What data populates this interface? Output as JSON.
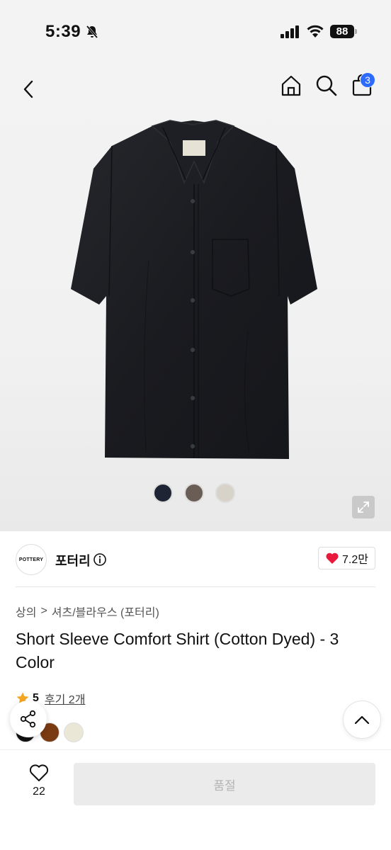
{
  "status_bar": {
    "time": "5:39",
    "battery": "88"
  },
  "header": {
    "cart_count": "3"
  },
  "hero": {
    "swatches": [
      {
        "name": "navy",
        "color": "#1e2433"
      },
      {
        "name": "brown",
        "color": "#6a5d55"
      },
      {
        "name": "beige",
        "color": "#d7d3c8"
      }
    ]
  },
  "brand": {
    "logo_text": "POTTERY",
    "name": "포터리",
    "like_count": "7.2만"
  },
  "breadcrumb": {
    "level1": "상의",
    "separator": ">",
    "level2": "셔츠/블라우스 (포터리)"
  },
  "product": {
    "title": "Short Sleeve Comfort Shirt (Cotton Dyed) - 3 Color",
    "rating": "5",
    "reviews": "후기 2개"
  },
  "color_options": [
    "#111111",
    "#7a3a12",
    "#ebe7d6"
  ],
  "bottom": {
    "wish_count": "22",
    "buy_label": "품절"
  },
  "colors": {
    "accent": "#2d6bff",
    "heart": "#e8193c",
    "star": "#f5a623"
  }
}
